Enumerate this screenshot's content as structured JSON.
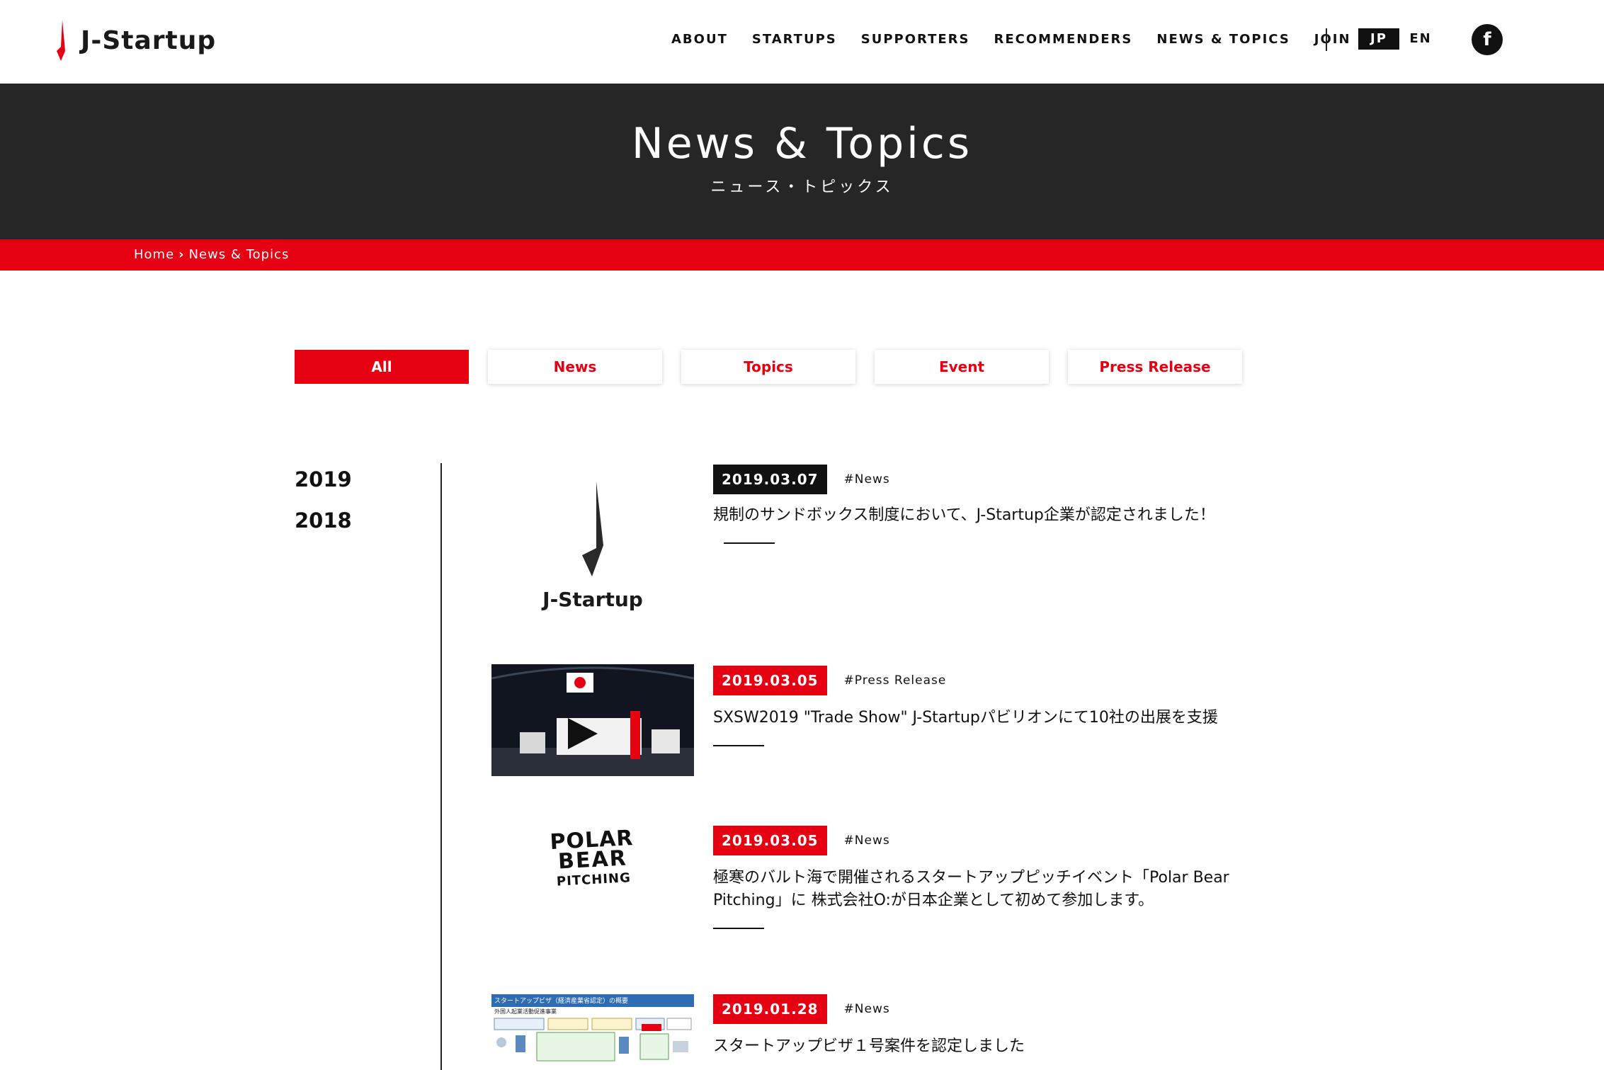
{
  "header": {
    "logo_text": "J-Startup",
    "nav": [
      "ABOUT",
      "STARTUPS",
      "SUPPORTERS",
      "RECOMMENDERS",
      "NEWS & TOPICS",
      "JOIN"
    ],
    "lang_jp": "JP",
    "lang_en": "EN",
    "facebook": "f"
  },
  "hero": {
    "title": "News & Topics",
    "subtitle": "ニュース・トピックス"
  },
  "breadcrumb": {
    "home": "Home",
    "current": "News & Topics"
  },
  "tabs": [
    "All",
    "News",
    "Topics",
    "Event",
    "Press Release"
  ],
  "years": [
    "2019",
    "2018"
  ],
  "articles": [
    {
      "date": "2019.03.07",
      "tag": "#News",
      "title": "規制のサンドボックス制度において、J-Startup企業が認定されました！",
      "thumb": "j-startup-logo"
    },
    {
      "date": "2019.03.05",
      "tag": "#Press Release",
      "title": "SXSW2019 \"Trade Show\" J-Startupパビリオンにて10社の出展を支援",
      "thumb": "pavilion-render"
    },
    {
      "date": "2019.03.05",
      "tag": "#News",
      "title": "極寒のバルト海で開催されるスタートアップピッチイベント「Polar Bear Pitching」に 株式会社O:が日本企業として初めて参加します。",
      "thumb": "polar-bear-pitching-logo",
      "thumb_lines": [
        "POLAR",
        "BEAR",
        "PITCHING"
      ]
    },
    {
      "date": "2019.01.28",
      "tag": "#News",
      "title": "スタートアップビザ１号案件を認定しました",
      "thumb": "startup-visa-diagram",
      "thumb_heading": "スタートアップビザ（経済産業省認定）の概要",
      "thumb_subheading": "外国人起業活動促進事業"
    }
  ],
  "colors": {
    "accent": "#e50012",
    "dark": "#262626"
  }
}
